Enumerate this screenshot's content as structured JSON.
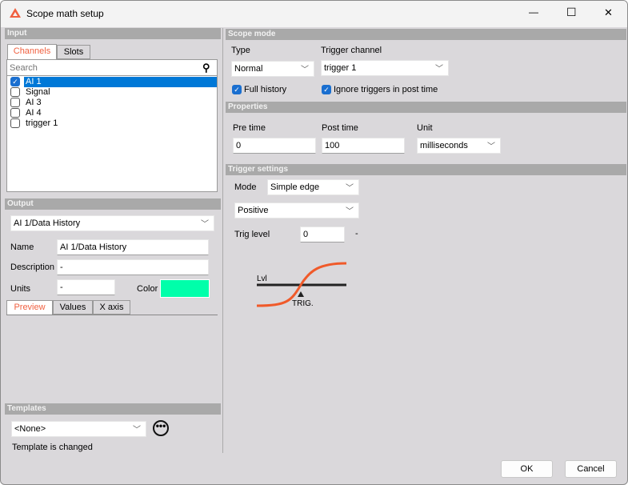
{
  "window": {
    "title": "Scope math setup",
    "controls": {
      "minimize": "—",
      "maximize": "☐",
      "close": "✕"
    }
  },
  "input": {
    "header": "Input",
    "tabs": [
      "Channels",
      "Slots"
    ],
    "search_placeholder": "Search",
    "channels": [
      {
        "label": "AI 1",
        "checked": true,
        "selected": true
      },
      {
        "label": "Signal",
        "checked": false
      },
      {
        "label": "AI 3",
        "checked": false
      },
      {
        "label": "AI 4",
        "checked": false
      },
      {
        "label": "trigger 1",
        "checked": false
      }
    ]
  },
  "output": {
    "header": "Output",
    "selected": "AI 1/Data History",
    "name_label": "Name",
    "name": "AI 1/Data History",
    "description_label": "Description",
    "description": "-",
    "units_label": "Units",
    "units": "-",
    "color_label": "Color",
    "color": "#00ffaa",
    "tabs": [
      "Preview",
      "Values",
      "X axis"
    ]
  },
  "templates": {
    "header": "Templates",
    "selected": "<None>",
    "status": "Template is changed"
  },
  "scope_mode": {
    "header": "Scope mode",
    "type_label": "Type",
    "type": "Normal",
    "trigger_channel_label": "Trigger channel",
    "trigger_channel": "trigger 1",
    "full_history_label": "Full history",
    "full_history": true,
    "ignore_label": "Ignore triggers in post time",
    "ignore": true
  },
  "properties": {
    "header": "Properties",
    "pre_label": "Pre time",
    "pre": "0",
    "post_label": "Post time",
    "post": "100",
    "unit_label": "Unit",
    "unit": "milliseconds"
  },
  "trigger": {
    "header": "Trigger settings",
    "mode_label": "Mode",
    "mode": "Simple edge",
    "edge": "Positive",
    "level_label": "Trig level",
    "level": "0",
    "level_unit": "-",
    "diagram": {
      "lvl": "Lvl",
      "trig": "TRIG."
    }
  },
  "buttons": {
    "ok": "OK",
    "cancel": "Cancel"
  },
  "colors": {
    "accent": "#f06040",
    "selection": "#0078d7",
    "header": "#a9a9a9"
  }
}
